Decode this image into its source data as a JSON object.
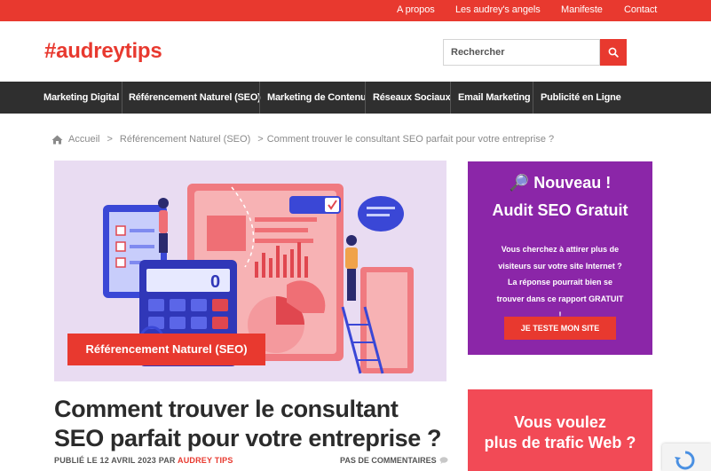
{
  "topbar": {
    "links": [
      "A propos",
      "Les audrey's angels",
      "Manifeste",
      "Contact"
    ]
  },
  "header": {
    "logo": "#audreytips",
    "search_placeholder": "Rechercher"
  },
  "nav": {
    "items": [
      "Marketing Digital",
      "Référencement Naturel (SEO)",
      "Marketing de Contenu",
      "Réseaux Sociaux",
      "Email Marketing",
      "Publicité en Ligne"
    ]
  },
  "breadcrumb": {
    "home": "Accueil",
    "category": "Référencement Naturel (SEO)",
    "current": "Comment trouver le consultant SEO parfait pour votre entreprise ?",
    "separator": ">"
  },
  "hero": {
    "tag": "Référencement Naturel (SEO)",
    "calculator_display": "0"
  },
  "article": {
    "title": "Comment trouver le consultant SEO parfait pour votre entreprise ?",
    "published_prefix": "PUBLIÉ LE 12 AVRIL 2023 ",
    "author_prefix": "PAR ",
    "author": "AUDREY TIPS",
    "comments": "PAS DE COMMENTAIRES"
  },
  "sidebar": {
    "audit": {
      "title_line1": "🔎 Nouveau !",
      "title_line2": "Audit SEO Gratuit",
      "text": "Vous cherchez à attirer plus de visiteurs sur votre site Internet ? La réponse pourrait bien se trouver dans ce rapport GRATUIT !",
      "button": "JE TESTE MON SITE"
    },
    "traffic": {
      "line1": "Vous voulez",
      "line2": "plus de trafic Web ?"
    }
  },
  "colors": {
    "accent": "#e8392f",
    "nav_bg": "#2f2f2f",
    "widget_purple": "#8b26a8",
    "widget_pink": "#f24a56",
    "hero_bg": "#e9dcf2"
  }
}
